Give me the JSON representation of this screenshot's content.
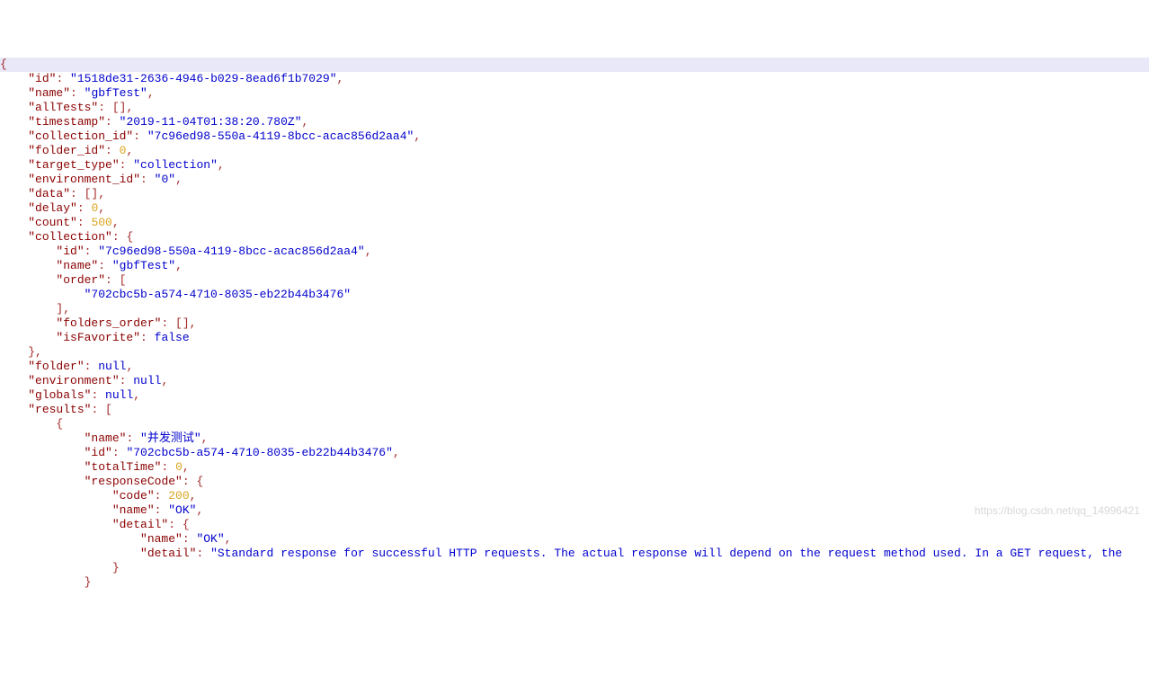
{
  "watermark": "https://blog.csdn.net/qq_14996421",
  "lines": [
    {
      "indent": 0,
      "hl": true,
      "tokens": [
        [
          "punc",
          "{"
        ]
      ]
    },
    {
      "indent": 1,
      "tokens": [
        [
          "key",
          "\"id\""
        ],
        [
          "punc",
          ": "
        ],
        [
          "str",
          "\"1518de31-2636-4946-b029-8ead6f1b7029\""
        ],
        [
          "punc",
          ","
        ]
      ]
    },
    {
      "indent": 1,
      "tokens": [
        [
          "key",
          "\"name\""
        ],
        [
          "punc",
          ": "
        ],
        [
          "str",
          "\"gbfTest\""
        ],
        [
          "punc",
          ","
        ]
      ]
    },
    {
      "indent": 1,
      "tokens": [
        [
          "key",
          "\"allTests\""
        ],
        [
          "punc",
          ": []"
        ],
        [
          "punc",
          ","
        ]
      ]
    },
    {
      "indent": 1,
      "tokens": [
        [
          "key",
          "\"timestamp\""
        ],
        [
          "punc",
          ": "
        ],
        [
          "str",
          "\"2019-11-04T01:38:20.780Z\""
        ],
        [
          "punc",
          ","
        ]
      ]
    },
    {
      "indent": 1,
      "tokens": [
        [
          "key",
          "\"collection_id\""
        ],
        [
          "punc",
          ": "
        ],
        [
          "str",
          "\"7c96ed98-550a-4119-8bcc-acac856d2aa4\""
        ],
        [
          "punc",
          ","
        ]
      ]
    },
    {
      "indent": 1,
      "tokens": [
        [
          "key",
          "\"folder_id\""
        ],
        [
          "punc",
          ": "
        ],
        [
          "num",
          "0"
        ],
        [
          "punc",
          ","
        ]
      ]
    },
    {
      "indent": 1,
      "tokens": [
        [
          "key",
          "\"target_type\""
        ],
        [
          "punc",
          ": "
        ],
        [
          "str",
          "\"collection\""
        ],
        [
          "punc",
          ","
        ]
      ]
    },
    {
      "indent": 1,
      "tokens": [
        [
          "key",
          "\"environment_id\""
        ],
        [
          "punc",
          ": "
        ],
        [
          "str",
          "\"0\""
        ],
        [
          "punc",
          ","
        ]
      ]
    },
    {
      "indent": 1,
      "tokens": [
        [
          "key",
          "\"data\""
        ],
        [
          "punc",
          ": []"
        ],
        [
          "punc",
          ","
        ]
      ]
    },
    {
      "indent": 1,
      "tokens": [
        [
          "key",
          "\"delay\""
        ],
        [
          "punc",
          ": "
        ],
        [
          "num",
          "0"
        ],
        [
          "punc",
          ","
        ]
      ]
    },
    {
      "indent": 1,
      "tokens": [
        [
          "key",
          "\"count\""
        ],
        [
          "punc",
          ": "
        ],
        [
          "num",
          "500"
        ],
        [
          "punc",
          ","
        ]
      ]
    },
    {
      "indent": 1,
      "tokens": [
        [
          "key",
          "\"collection\""
        ],
        [
          "punc",
          ": {"
        ]
      ]
    },
    {
      "indent": 2,
      "tokens": [
        [
          "key",
          "\"id\""
        ],
        [
          "punc",
          ": "
        ],
        [
          "str",
          "\"7c96ed98-550a-4119-8bcc-acac856d2aa4\""
        ],
        [
          "punc",
          ","
        ]
      ]
    },
    {
      "indent": 2,
      "tokens": [
        [
          "key",
          "\"name\""
        ],
        [
          "punc",
          ": "
        ],
        [
          "str",
          "\"gbfTest\""
        ],
        [
          "punc",
          ","
        ]
      ]
    },
    {
      "indent": 2,
      "tokens": [
        [
          "key",
          "\"order\""
        ],
        [
          "punc",
          ": ["
        ]
      ]
    },
    {
      "indent": 3,
      "tokens": [
        [
          "str",
          "\"702cbc5b-a574-4710-8035-eb22b44b3476\""
        ]
      ]
    },
    {
      "indent": 2,
      "tokens": [
        [
          "punc",
          "],"
        ]
      ]
    },
    {
      "indent": 2,
      "tokens": [
        [
          "key",
          "\"folders_order\""
        ],
        [
          "punc",
          ": []"
        ],
        [
          "punc",
          ","
        ]
      ]
    },
    {
      "indent": 2,
      "tokens": [
        [
          "key",
          "\"isFavorite\""
        ],
        [
          "punc",
          ": "
        ],
        [
          "kw",
          "false"
        ]
      ]
    },
    {
      "indent": 1,
      "tokens": [
        [
          "punc",
          "},"
        ]
      ]
    },
    {
      "indent": 1,
      "tokens": [
        [
          "key",
          "\"folder\""
        ],
        [
          "punc",
          ": "
        ],
        [
          "kw",
          "null"
        ],
        [
          "punc",
          ","
        ]
      ]
    },
    {
      "indent": 1,
      "tokens": [
        [
          "key",
          "\"environment\""
        ],
        [
          "punc",
          ": "
        ],
        [
          "kw",
          "null"
        ],
        [
          "punc",
          ","
        ]
      ]
    },
    {
      "indent": 1,
      "tokens": [
        [
          "key",
          "\"globals\""
        ],
        [
          "punc",
          ": "
        ],
        [
          "kw",
          "null"
        ],
        [
          "punc",
          ","
        ]
      ]
    },
    {
      "indent": 1,
      "tokens": [
        [
          "key",
          "\"results\""
        ],
        [
          "punc",
          ": ["
        ]
      ]
    },
    {
      "indent": 2,
      "tokens": [
        [
          "punc",
          "{"
        ]
      ]
    },
    {
      "indent": 3,
      "tokens": [
        [
          "key",
          "\"name\""
        ],
        [
          "punc",
          ": "
        ],
        [
          "str",
          "\"并发测试\""
        ],
        [
          "punc",
          ","
        ]
      ]
    },
    {
      "indent": 3,
      "tokens": [
        [
          "key",
          "\"id\""
        ],
        [
          "punc",
          ": "
        ],
        [
          "str",
          "\"702cbc5b-a574-4710-8035-eb22b44b3476\""
        ],
        [
          "punc",
          ","
        ]
      ]
    },
    {
      "indent": 3,
      "tokens": [
        [
          "key",
          "\"totalTime\""
        ],
        [
          "punc",
          ": "
        ],
        [
          "num",
          "0"
        ],
        [
          "punc",
          ","
        ]
      ]
    },
    {
      "indent": 3,
      "tokens": [
        [
          "key",
          "\"responseCode\""
        ],
        [
          "punc",
          ": {"
        ]
      ]
    },
    {
      "indent": 4,
      "tokens": [
        [
          "key",
          "\"code\""
        ],
        [
          "punc",
          ": "
        ],
        [
          "num",
          "200"
        ],
        [
          "punc",
          ","
        ]
      ]
    },
    {
      "indent": 4,
      "tokens": [
        [
          "key",
          "\"name\""
        ],
        [
          "punc",
          ": "
        ],
        [
          "str",
          "\"OK\""
        ],
        [
          "punc",
          ","
        ]
      ]
    },
    {
      "indent": 4,
      "tokens": [
        [
          "key",
          "\"detail\""
        ],
        [
          "punc",
          ": {"
        ]
      ]
    },
    {
      "indent": 5,
      "tokens": [
        [
          "key",
          "\"name\""
        ],
        [
          "punc",
          ": "
        ],
        [
          "str",
          "\"OK\""
        ],
        [
          "punc",
          ","
        ]
      ]
    },
    {
      "indent": 5,
      "tokens": [
        [
          "key",
          "\"detail\""
        ],
        [
          "punc",
          ": "
        ],
        [
          "str",
          "\"Standard response for successful HTTP requests. The actual response will depend on the request method used. In a GET request, the"
        ]
      ]
    },
    {
      "indent": 4,
      "tokens": [
        [
          "punc",
          "}"
        ]
      ]
    },
    {
      "indent": 3,
      "tokens": [
        [
          "punc",
          "}"
        ]
      ]
    }
  ]
}
